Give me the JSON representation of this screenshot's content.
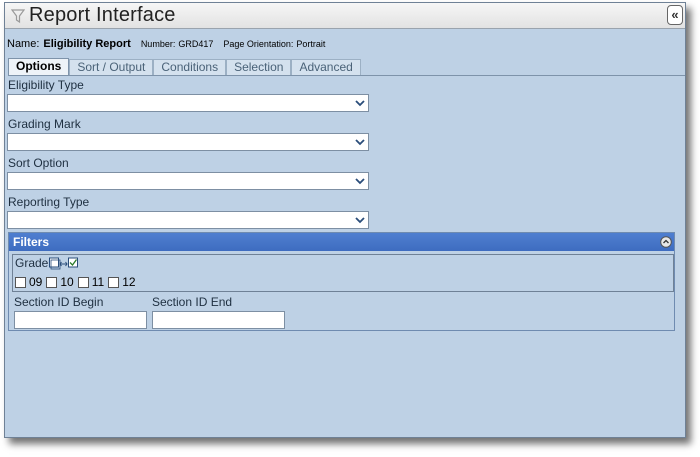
{
  "window": {
    "title": "Report Interface"
  },
  "info": {
    "name_label": "Name:",
    "name_value": "Eligibility Report",
    "number_label": "Number:",
    "number_value": "GRD417",
    "orientation_label": "Page Orientation:",
    "orientation_value": "Portrait"
  },
  "tabs": [
    {
      "label": "Options",
      "active": true
    },
    {
      "label": "Sort / Output",
      "active": false
    },
    {
      "label": "Conditions",
      "active": false
    },
    {
      "label": "Selection",
      "active": false
    },
    {
      "label": "Advanced",
      "active": false
    }
  ],
  "fields": [
    {
      "label": "Eligibility Type",
      "value": ""
    },
    {
      "label": "Grading Mark",
      "value": ""
    },
    {
      "label": "Sort Option",
      "value": ""
    },
    {
      "label": "Reporting Type",
      "value": ""
    }
  ],
  "filters": {
    "title": "Filters",
    "grade_label": "Grade",
    "grades": [
      {
        "label": "09",
        "checked": false
      },
      {
        "label": "10",
        "checked": false
      },
      {
        "label": "11",
        "checked": false
      },
      {
        "label": "12",
        "checked": false
      }
    ],
    "section_begin_label": "Section ID Begin",
    "section_end_label": "Section ID End",
    "section_begin_value": "",
    "section_end_value": ""
  },
  "icons": {
    "title_icon": "filter-funnel-icon",
    "collapse": "double-chevron-left-icon",
    "dropdown": "chevron-down-icon",
    "filters_toggle": "collapse-circle-icon",
    "grade_toggle": "checkbox-toggle-icon"
  }
}
